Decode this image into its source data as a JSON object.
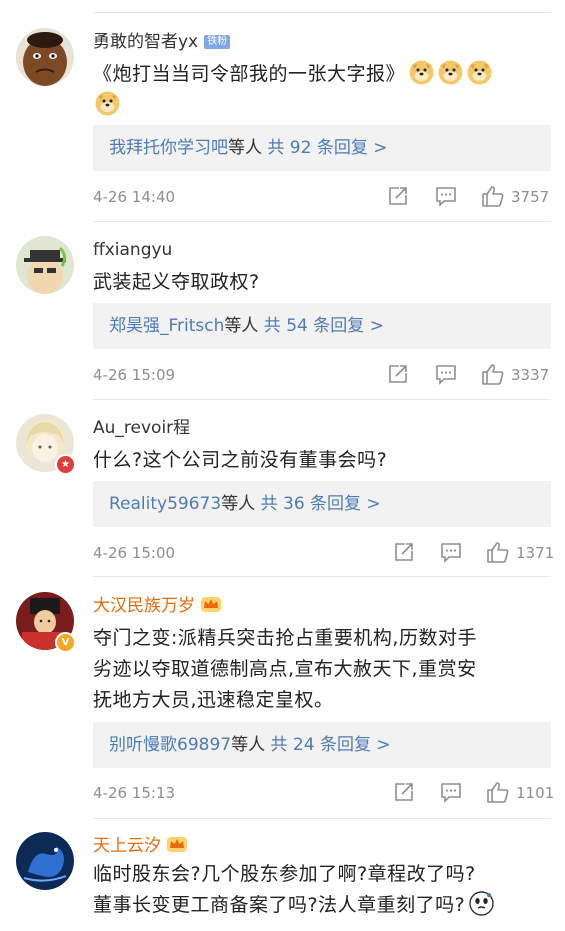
{
  "comments": [
    {
      "username": "勇敢的智者yx",
      "badge": "铁粉",
      "text": "《炮打当当司令部我的一张大字报》",
      "emojis": [
        "doge-icon",
        "doge-icon",
        "doge-icon",
        "doge-icon"
      ],
      "reply_names": "我拜托你学习吧",
      "reply_mid": "等人",
      "reply_count": "共 92 条回复 >",
      "time": "4-26 14:40",
      "likes": "3757"
    },
    {
      "username": "ffxiangyu",
      "text": "武装起义夺取政权?",
      "reply_names": "郑昊强_Fritsch",
      "reply_mid": "等人",
      "reply_count": "共 54 条回复 >",
      "time": "4-26 15:09",
      "likes": "3337"
    },
    {
      "username": "Au_revoir程",
      "text": "什么?这个公司之前没有董事会吗?",
      "reply_names": "Reality59673",
      "reply_mid": "等人",
      "reply_count": "共 36 条回复 >",
      "time": "4-26 15:00",
      "likes": "1371"
    },
    {
      "username": "大汉民族万岁",
      "badge_v": "V",
      "text_lines": [
        "夺门之变:派精兵突击抢占重要机构,历数对手",
        "劣迹以夺取道德制高点,宣布大赦天下,重赏安",
        "抚地方大员,迅速稳定皇权。"
      ],
      "reply_names": "别听慢歌69897",
      "reply_mid": "等人",
      "reply_count": "共 24 条回复 >",
      "time": "4-26 15:13",
      "likes": "1101"
    },
    {
      "username": "天上云汐",
      "text_lines": [
        "临时股东会?几个股东参加了啊?章程改了吗?",
        "董事长变更工商备案了吗?法人章重刻了吗?"
      ],
      "emojis": [
        "thinking-face-icon"
      ]
    }
  ],
  "colors": {
    "link": "#4e7bb3",
    "vip_name": "#e86b0b",
    "meta": "#8f8f8f",
    "reply_bg": "#f2f2f2",
    "vbadge": "#f5a623",
    "red_badge": "#e03c3c"
  }
}
